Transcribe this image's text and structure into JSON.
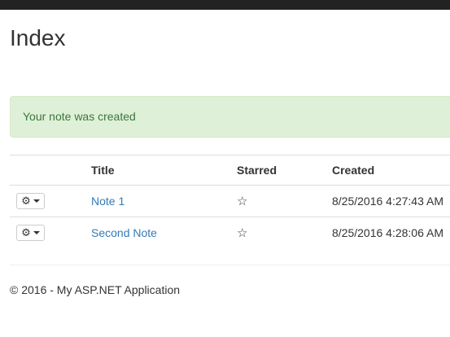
{
  "page": {
    "title": "Index"
  },
  "alert": {
    "message": "Your note was created",
    "color": "#3c763d",
    "background": "#dff0d8"
  },
  "table": {
    "headers": [
      "",
      "Title",
      "Starred",
      "Created"
    ],
    "rows": [
      {
        "title": "Note 1",
        "starred": false,
        "star_icon": "star-outline-icon",
        "created": "8/25/2016 4:27:43 AM"
      },
      {
        "title": "Second Note",
        "starred": false,
        "star_icon": "star-outline-icon",
        "created": "8/25/2016 4:28:06 AM"
      }
    ]
  },
  "footer": {
    "text": "© 2016 - My ASP.NET Application"
  },
  "colors": {
    "link": "#337ab7",
    "topbar": "#222222"
  }
}
